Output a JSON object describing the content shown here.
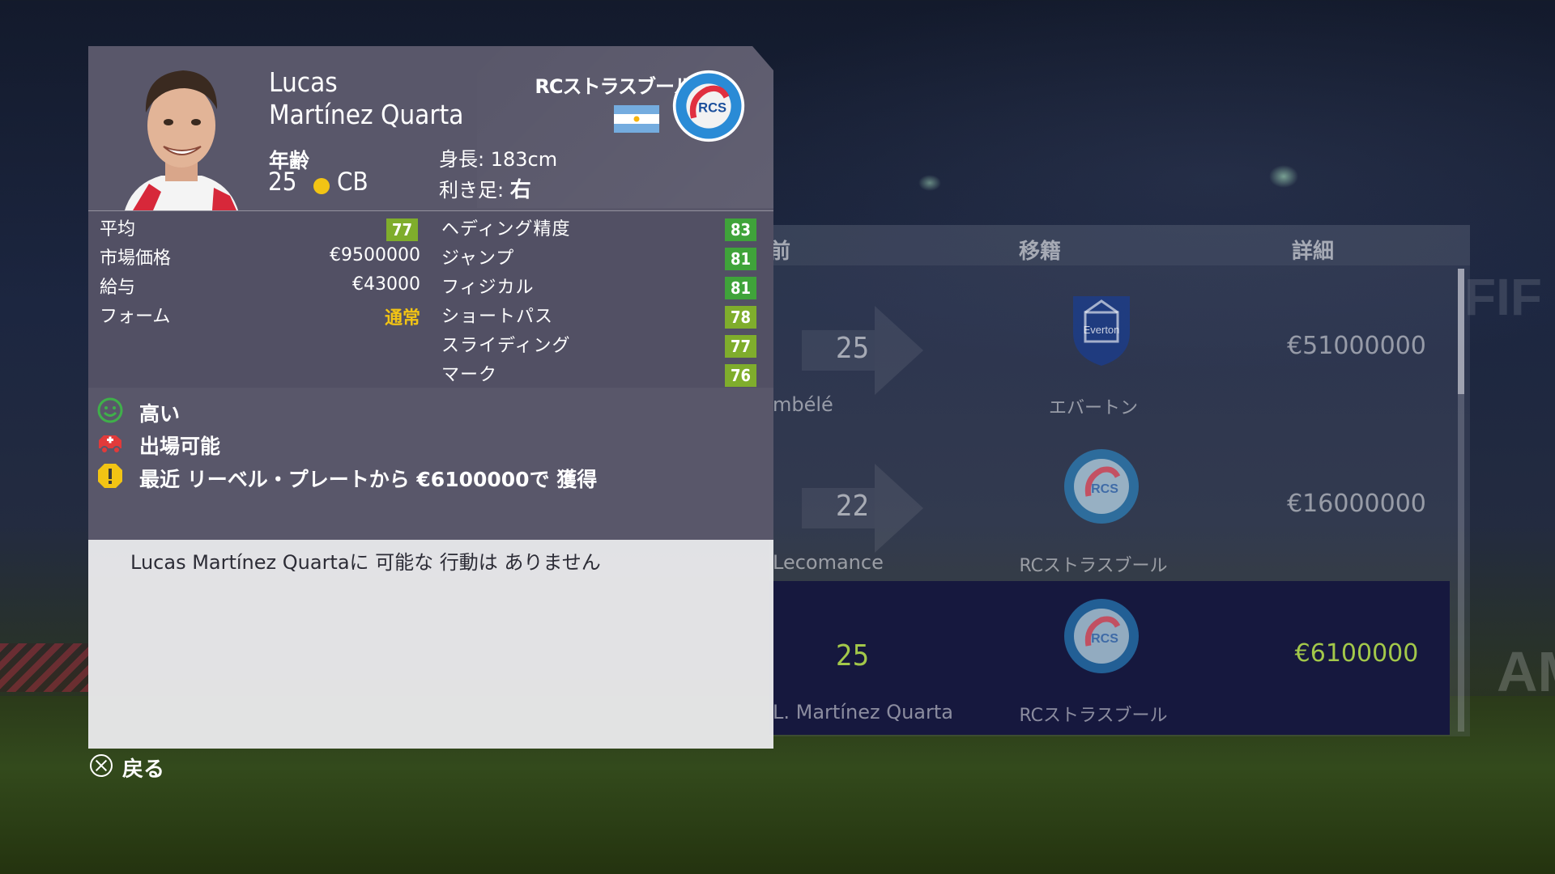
{
  "player": {
    "first_name": "Lucas",
    "last_name": "Martínez Quarta",
    "age_label": "年齢",
    "age": "25",
    "position": "CB",
    "height": "身長: 183cm",
    "foot_label": "利き足: ",
    "foot": "右",
    "club": "RCストラスブール",
    "nationality_flag": "argentina-flag"
  },
  "left_stats": [
    {
      "label": "平均",
      "value": "77",
      "type": "badge",
      "color": "#7fad2c"
    },
    {
      "label": "市場価格",
      "value": "€9500000",
      "type": "text"
    },
    {
      "label": "給与",
      "value": "€43000",
      "type": "text"
    },
    {
      "label": "フォーム",
      "value": "通常",
      "type": "text",
      "color": "#f2c414"
    }
  ],
  "right_stats": [
    {
      "label": "ヘディング精度",
      "value": "83",
      "color": "#3fa33a"
    },
    {
      "label": "ジャンプ",
      "value": "81",
      "color": "#3fa33a"
    },
    {
      "label": "フィジカル",
      "value": "81",
      "color": "#3fa33a"
    },
    {
      "label": "ショートパス",
      "value": "78",
      "color": "#7fad2c"
    },
    {
      "label": "スライディング",
      "value": "77",
      "color": "#7fad2c"
    },
    {
      "label": "マーク",
      "value": "76",
      "color": "#7fad2c"
    }
  ],
  "status": [
    {
      "icon": "smile-icon",
      "text": "高い"
    },
    {
      "icon": "injury-icon",
      "text": "出場可能"
    },
    {
      "icon": "warning-icon",
      "text": "最近 リーベル・プレートから €6100000で 獲得"
    }
  ],
  "actions_message": "Lucas Martínez Quartaに 可能な 行動は ありません",
  "back_label": "戻る",
  "bg_table": {
    "headers": [
      "前",
      "移籍",
      "詳細"
    ],
    "rows": [
      {
        "age": "25",
        "name": "mbélé",
        "club": "エバートン",
        "fee": "€51000000",
        "crest": "everton-crest"
      },
      {
        "age": "22",
        "name": "Lecomance",
        "club": "RCストラスブール",
        "fee": "€16000000",
        "crest": "strasbourg-crest"
      },
      {
        "age": "25",
        "name": "L. Martínez Quarta",
        "club": "RCストラスブール",
        "fee": "€6100000",
        "crest": "strasbourg-crest"
      }
    ]
  },
  "colors": {
    "card": "#59576a",
    "good_green": "#3fa33a",
    "mid_green": "#7fad2c",
    "gold": "#f2c414"
  }
}
